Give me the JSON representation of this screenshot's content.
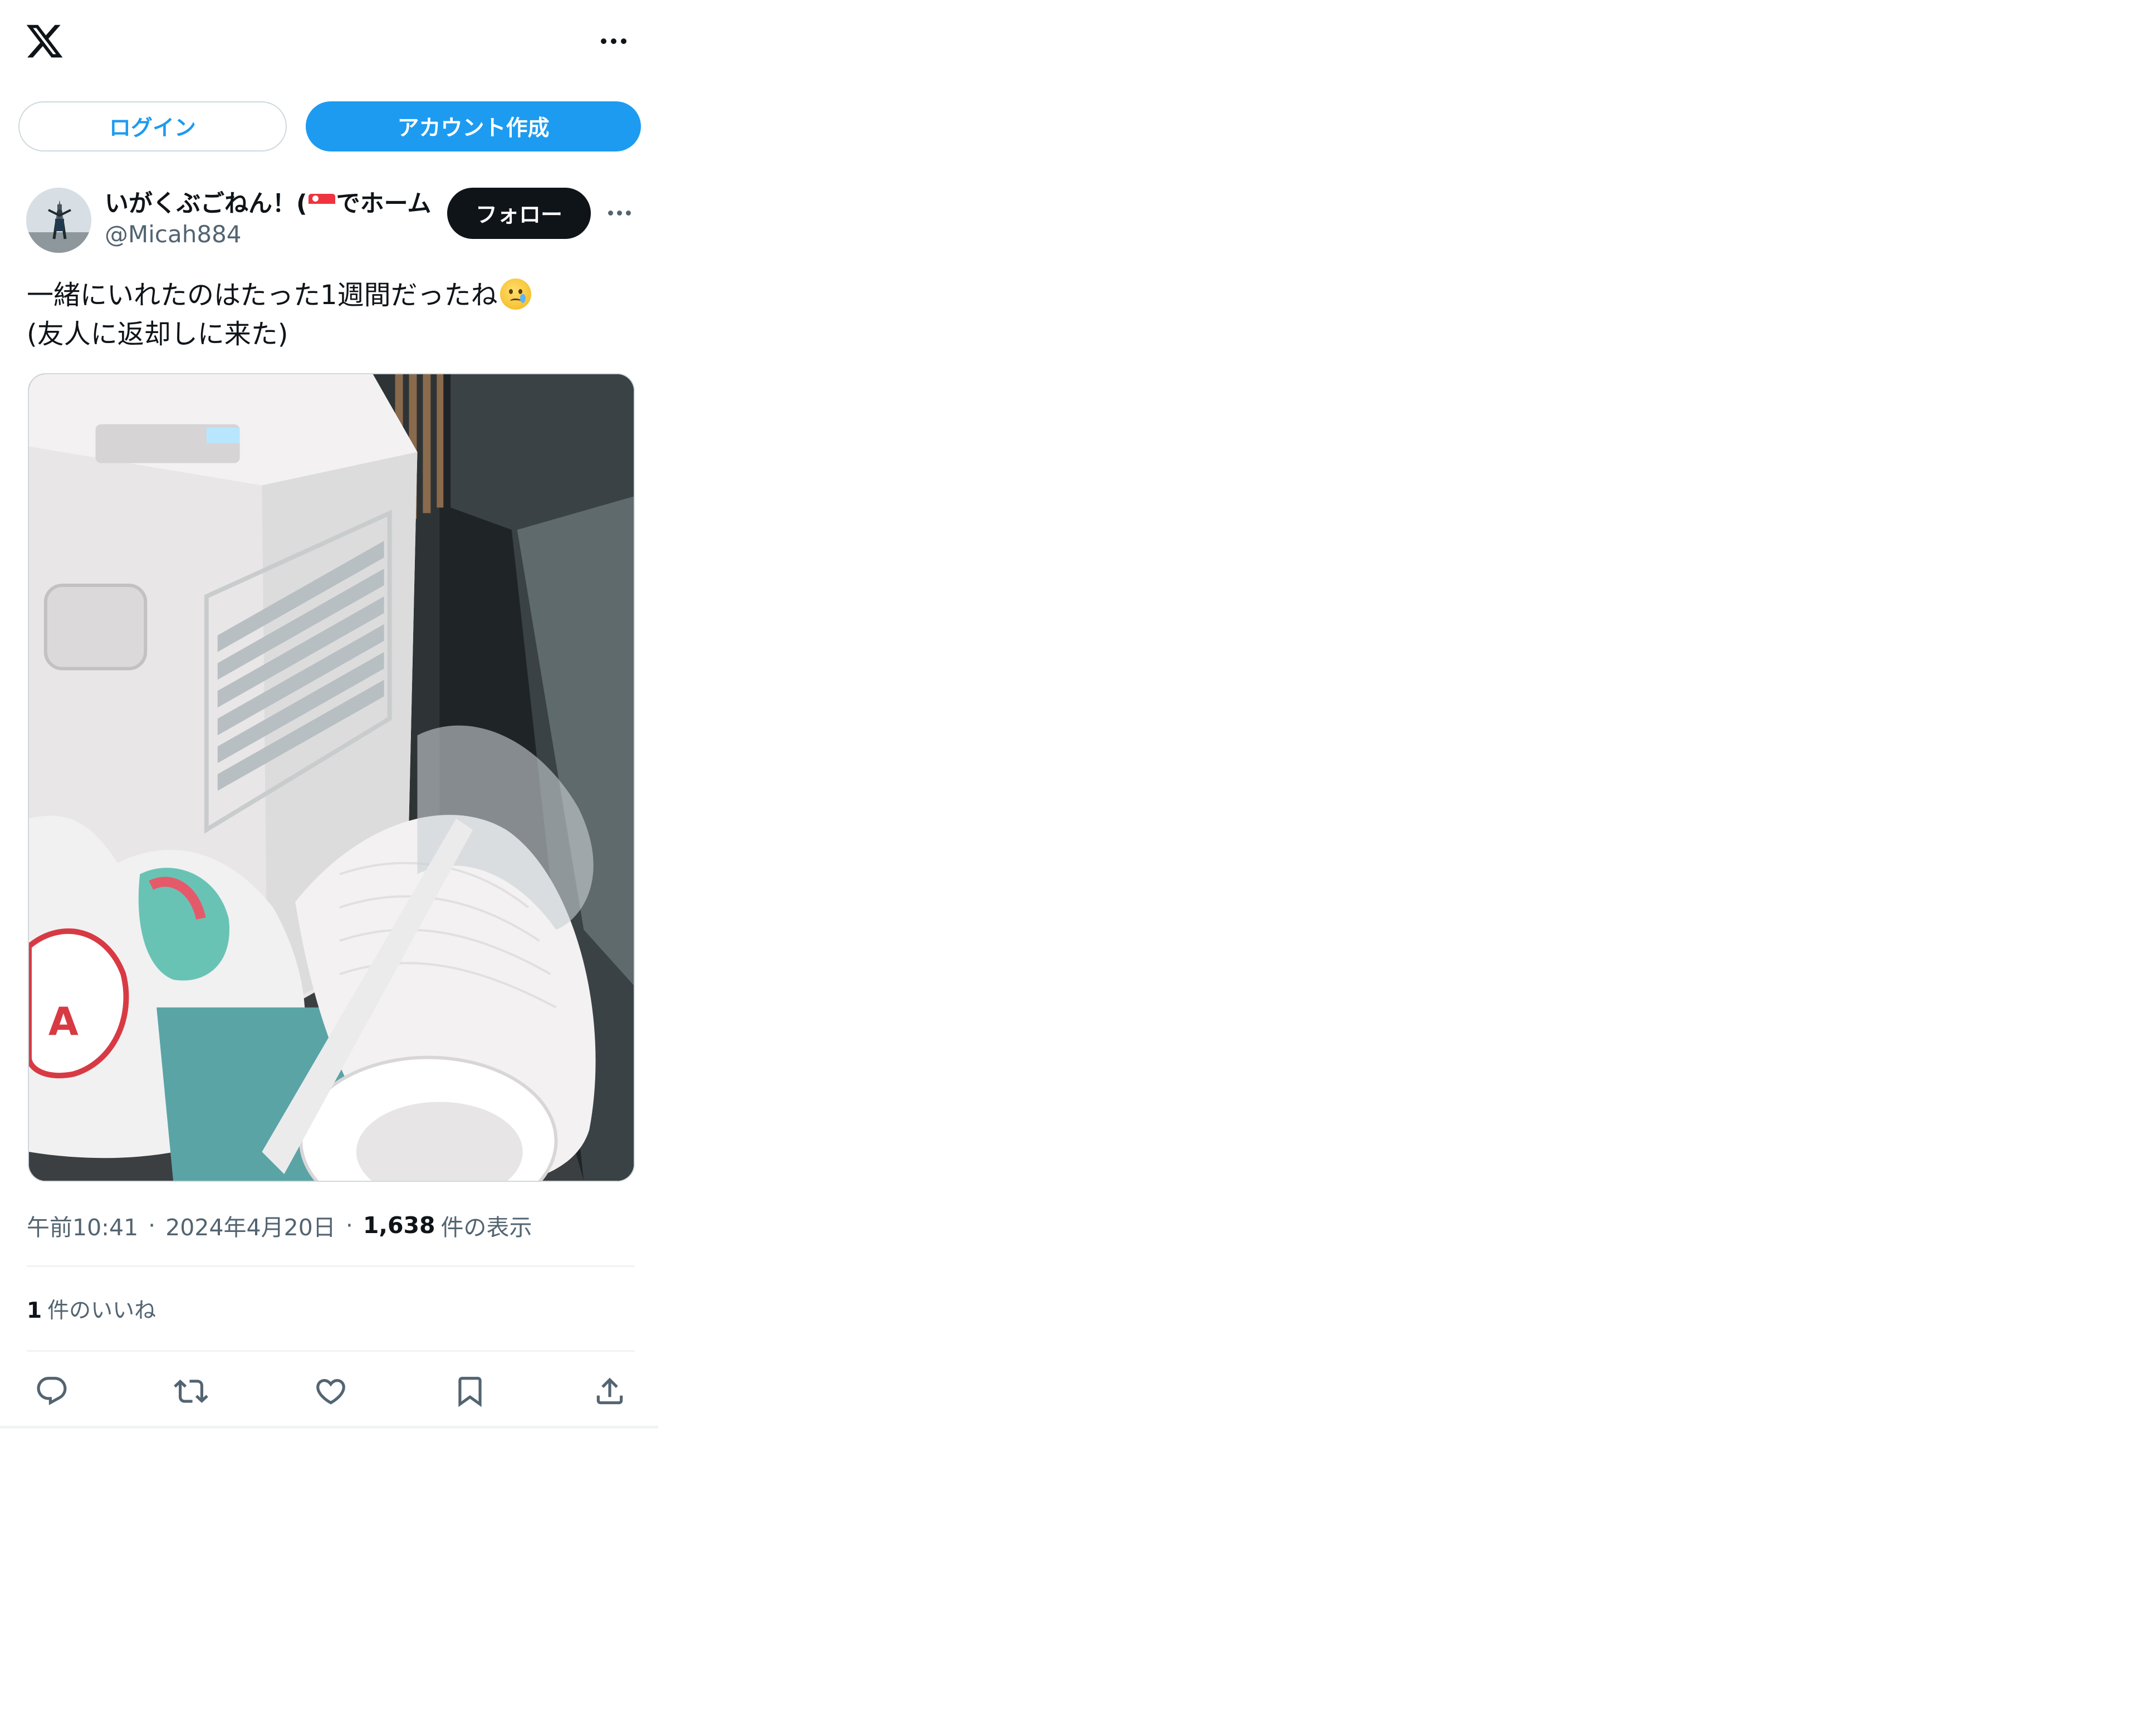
{
  "topbar": {
    "logo_icon": "x-logo-icon",
    "more_icon": "more-horizontal-icon"
  },
  "auth": {
    "login_label": "ログイン",
    "signup_label": "アカウント作成"
  },
  "tweet": {
    "author": {
      "name_before_flag": "いがくぶごねん！(",
      "flag": "singapore-flag",
      "name_after_flag": "でホーム",
      "handle": "@Micah884"
    },
    "follow_label": "フォロー",
    "text_line1": "一緒にいれたのはたった1週間だったね",
    "text_emoji": "face-holding-back-tears",
    "text_line2": "(友人に返却しに来た)",
    "time": "午前10:41",
    "date": "2024年4月20日",
    "separator": "·",
    "views_count": "1,638",
    "views_label": "件の表示",
    "likes_count": "1",
    "likes_label": "件のいいね"
  },
  "actions": [
    "reply-icon",
    "retweet-icon",
    "like-icon",
    "bookmark-icon",
    "share-icon"
  ],
  "colors": {
    "accent": "#1d9bf0",
    "text": "#0f1419",
    "secondary": "#536471",
    "divider": "#eff3f4",
    "follow_bg": "#0f1419"
  }
}
